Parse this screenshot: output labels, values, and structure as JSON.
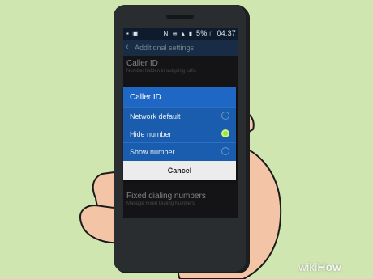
{
  "status_bar": {
    "left_icons": [
      "sim-icon",
      "image-icon"
    ],
    "right_icons": [
      "nfc-icon",
      "wifi-icon",
      "data-icon",
      "signal-icon"
    ],
    "battery": "5%",
    "time": "04:37"
  },
  "action_bar": {
    "title": "Additional settings"
  },
  "settings": [
    {
      "title": "Caller ID",
      "subtitle": "Number hidden in outgoing calls"
    },
    {
      "title": "Fixed dialing numbers",
      "subtitle": "Manage Fixed Dialing Numbers"
    }
  ],
  "dialog": {
    "title": "Caller ID",
    "options": [
      {
        "label": "Network default",
        "selected": false
      },
      {
        "label": "Hide number",
        "selected": true
      },
      {
        "label": "Show number",
        "selected": false
      }
    ],
    "cancel_label": "Cancel"
  },
  "watermark": {
    "prefix": "wiki",
    "suffix": "How"
  },
  "colors": {
    "dialog_accent": "#1e67c4",
    "selected_radio": "#9be23b",
    "background": "#cfe6b0"
  }
}
